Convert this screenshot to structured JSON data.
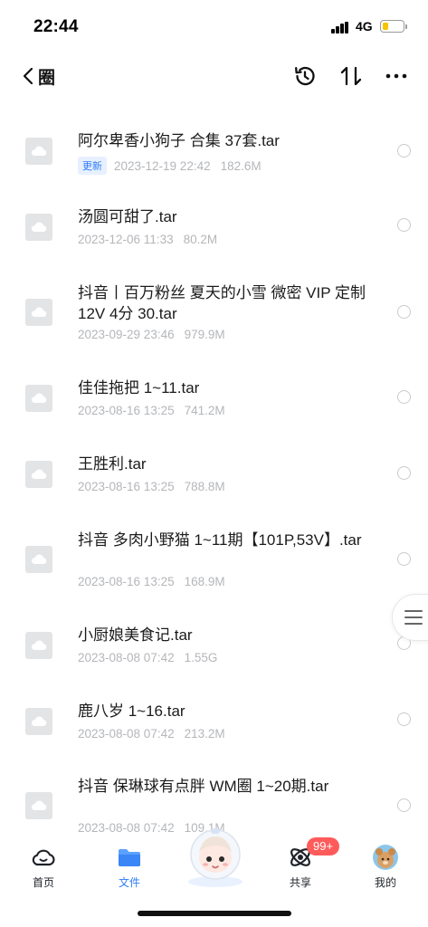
{
  "status_bar": {
    "time": "22:44",
    "network": "4G"
  },
  "header": {
    "title": "圈"
  },
  "files": [
    {
      "name": "阿尔卑香小狗子 合集 37套.tar",
      "badge": "更新",
      "date": "2023-12-19 22:42",
      "size": "182.6M"
    },
    {
      "name": "汤圆可甜了.tar",
      "date": "2023-12-06 11:33",
      "size": "80.2M"
    },
    {
      "name": "抖音丨百万粉丝 夏天的小雪 微密 VIP 定制 12V 4分 30.tar",
      "date": "2023-09-29 23:46",
      "size": "979.9M"
    },
    {
      "name": "佳佳拖把 1~11.tar",
      "date": "2023-08-16 13:25",
      "size": "741.2M"
    },
    {
      "name": "王胜利.tar",
      "date": "2023-08-16 13:25",
      "size": "788.8M"
    },
    {
      "name": "抖音 多肉小野猫 1~11期【101P,53V】.tar",
      "date": "2023-08-16 13:25",
      "size": "168.9M"
    },
    {
      "name": "小厨娘美食记.tar",
      "date": "2023-08-08 07:42",
      "size": "1.55G"
    },
    {
      "name": "鹿八岁 1~16.tar",
      "date": "2023-08-08 07:42",
      "size": "213.2M"
    },
    {
      "name": "抖音 保琳球有点胖 WM圈 1~20期.tar",
      "date": "2023-08-08 07:42",
      "size": "109.1M"
    }
  ],
  "tabs": [
    {
      "label": "首页",
      "icon": "cloud-icon"
    },
    {
      "label": "文件",
      "icon": "folder-icon"
    },
    {
      "label": "共享",
      "icon": "orbit-icon"
    },
    {
      "label": "我的",
      "icon": "avatar-icon"
    }
  ],
  "share_badge": "99+",
  "colors": {
    "accent": "#2f7cf6",
    "badge_red": "#ff5b5b",
    "meta_gray": "#b4b6ba"
  }
}
